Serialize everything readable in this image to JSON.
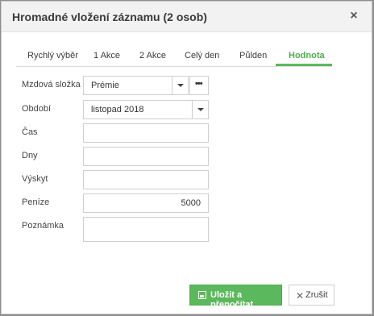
{
  "dialog": {
    "title": "Hromadné vložení záznamu (2 osob)",
    "close_icon": "×"
  },
  "tabs": [
    {
      "label": "Rychlý výběr",
      "active": false
    },
    {
      "label": "1 Akce",
      "active": false
    },
    {
      "label": "2 Akce",
      "active": false
    },
    {
      "label": "Celý den",
      "active": false
    },
    {
      "label": "Půlden",
      "active": false
    },
    {
      "label": "Hodnota",
      "active": true
    }
  ],
  "form": {
    "mzdova_slozka": {
      "label": "Mzdová složka",
      "value": "Prémie"
    },
    "obdobi": {
      "label": "Období",
      "value": "listopad 2018"
    },
    "cas": {
      "label": "Čas",
      "value": ""
    },
    "dny": {
      "label": "Dny",
      "value": ""
    },
    "vyskyt": {
      "label": "Výskyt",
      "value": ""
    },
    "penize": {
      "label": "Peníze",
      "value": "5000"
    },
    "poznamka": {
      "label": "Poznámka",
      "value": ""
    }
  },
  "buttons": {
    "save_label": "Uložit a přepočítat",
    "cancel_label": "Zrušit"
  },
  "colors": {
    "accent": "#5cb85c"
  }
}
